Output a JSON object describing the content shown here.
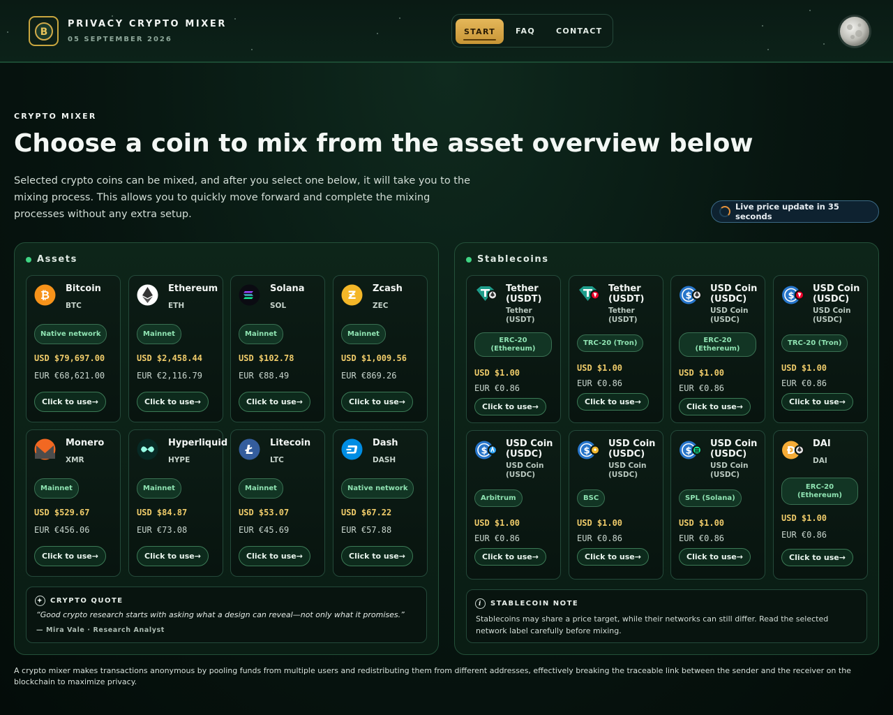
{
  "header": {
    "brand_title": "PRIVACY CRYPTO MIXER",
    "date": "05 SEPTEMBER 2026",
    "logo_icon": "bitcoin-shield-icon",
    "nav": {
      "start": "START",
      "faq": "FAQ",
      "contact": "CONTACT"
    },
    "theme_icon": "moon-icon"
  },
  "hero": {
    "eyebrow": "CRYPTO MIXER",
    "title": "Choose a coin to mix from the asset overview below",
    "description": "Selected crypto coins can be mixed, and after you select one below, it will take you to the mixing process. This allows you to quickly move forward and complete the mixing processes without any extra setup.",
    "live_update": "Live price update in 35 seconds"
  },
  "assets": {
    "heading": "Assets",
    "cards": [
      {
        "name": "Bitcoin",
        "symbol": "BTC",
        "network": "Native network",
        "usd": "USD $79,697.00",
        "eur": "EUR €68,621.00",
        "cta": "Click to use→",
        "icon": "bitcoin-icon",
        "color": "#f7931a"
      },
      {
        "name": "Ethereum",
        "symbol": "ETH",
        "network": "Mainnet",
        "usd": "USD $2,458.44",
        "eur": "EUR €2,116.79",
        "cta": "Click to use→",
        "icon": "ethereum-icon",
        "color": "#ffffff"
      },
      {
        "name": "Solana",
        "symbol": "SOL",
        "network": "Mainnet",
        "usd": "USD $102.78",
        "eur": "EUR €88.49",
        "cta": "Click to use→",
        "icon": "solana-icon",
        "color": "#14f195"
      },
      {
        "name": "Zcash",
        "symbol": "ZEC",
        "network": "Mainnet",
        "usd": "USD $1,009.56",
        "eur": "EUR €869.26",
        "cta": "Click to use→",
        "icon": "zcash-icon",
        "color": "#f4b728"
      },
      {
        "name": "Monero",
        "symbol": "XMR",
        "network": "Mainnet",
        "usd": "USD $529.67",
        "eur": "EUR €456.06",
        "cta": "Click to use→",
        "icon": "monero-icon",
        "color": "#f26822"
      },
      {
        "name": "Hyperliquid",
        "symbol": "HYPE",
        "network": "Mainnet",
        "usd": "USD $84.87",
        "eur": "EUR €73.08",
        "cta": "Click to use→",
        "icon": "hyperliquid-icon",
        "color": "#97fce4"
      },
      {
        "name": "Litecoin",
        "symbol": "LTC",
        "network": "Mainnet",
        "usd": "USD $53.07",
        "eur": "EUR €45.69",
        "cta": "Click to use→",
        "icon": "litecoin-icon",
        "color": "#345d9d"
      },
      {
        "name": "Dash",
        "symbol": "DASH",
        "network": "Native network",
        "usd": "USD $67.22",
        "eur": "EUR €57.88",
        "cta": "Click to use→",
        "icon": "dash-icon",
        "color": "#008de4"
      }
    ],
    "quote": {
      "title": "CRYPTO QUOTE",
      "text": "“Good crypto research starts with asking what a design can reveal—not only what it promises.”",
      "author": "— Mira Vale · Research Analyst"
    }
  },
  "stablecoins": {
    "heading": "Stablecoins",
    "cards": [
      {
        "name": "Tether (USDT)",
        "subname": "Tether (USDT)",
        "network": "ERC-20 (Ethereum)",
        "usd": "USD $1.00",
        "eur": "EUR €0.86",
        "cta": "Click to use→",
        "icon": "tether-icon",
        "chain_icon": "ethereum-chain-icon"
      },
      {
        "name": "Tether (USDT)",
        "subname": "Tether (USDT)",
        "network": "TRC-20 (Tron)",
        "usd": "USD $1.00",
        "eur": "EUR €0.86",
        "cta": "Click to use→",
        "icon": "tether-icon",
        "chain_icon": "tron-chain-icon"
      },
      {
        "name": "USD Coin (USDC)",
        "subname": "USD Coin (USDC)",
        "network": "ERC-20 (Ethereum)",
        "usd": "USD $1.00",
        "eur": "EUR €0.86",
        "cta": "Click to use→",
        "icon": "usdc-icon",
        "chain_icon": "ethereum-chain-icon"
      },
      {
        "name": "USD Coin (USDC)",
        "subname": "USD Coin (USDC)",
        "network": "TRC-20 (Tron)",
        "usd": "USD $1.00",
        "eur": "EUR €0.86",
        "cta": "Click to use→",
        "icon": "usdc-icon",
        "chain_icon": "tron-chain-icon"
      },
      {
        "name": "USD Coin (USDC)",
        "subname": "USD Coin (USDC)",
        "network": "Arbitrum",
        "usd": "USD $1.00",
        "eur": "EUR €0.86",
        "cta": "Click to use→",
        "icon": "usdc-icon",
        "chain_icon": "arbitrum-chain-icon"
      },
      {
        "name": "USD Coin (USDC)",
        "subname": "USD Coin (USDC)",
        "network": "BSC",
        "usd": "USD $1.00",
        "eur": "EUR €0.86",
        "cta": "Click to use→",
        "icon": "usdc-icon",
        "chain_icon": "bsc-chain-icon"
      },
      {
        "name": "USD Coin (USDC)",
        "subname": "USD Coin (USDC)",
        "network": "SPL (Solana)",
        "usd": "USD $1.00",
        "eur": "EUR €0.86",
        "cta": "Click to use→",
        "icon": "usdc-icon",
        "chain_icon": "solana-chain-icon"
      },
      {
        "name": "DAI",
        "subname": "DAI",
        "network": "ERC-20 (Ethereum)",
        "usd": "USD $1.00",
        "eur": "EUR €0.86",
        "cta": "Click to use→",
        "icon": "dai-icon",
        "chain_icon": "ethereum-chain-icon"
      }
    ],
    "note": {
      "title": "STABLECOIN NOTE",
      "text": "Stablecoins may share a price target, while their networks can still differ. Read the selected network label carefully before mixing."
    }
  },
  "footer": "A crypto mixer makes transactions anonymous by pooling funds from multiple users and redistributing them from different addresses, effectively breaking the traceable link between the sender and the receiver on the blockchain to maximize privacy.",
  "colors": {
    "accent_gold": "#d9a948",
    "accent_green": "#3fd483",
    "price_gold": "#f0cc6a"
  }
}
